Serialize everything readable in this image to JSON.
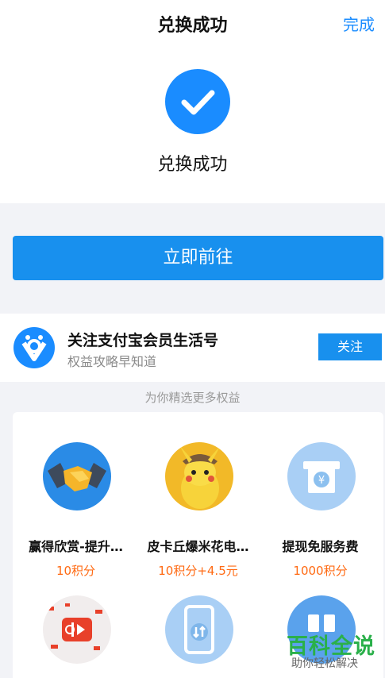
{
  "header": {
    "title": "兑换成功",
    "done_label": "完成"
  },
  "success": {
    "message": "兑换成功"
  },
  "action": {
    "go_label": "立即前往"
  },
  "follow": {
    "title": "关注支付宝会员生活号",
    "subtitle": "权益攻略早知道",
    "button_label": "关注"
  },
  "recommend": {
    "title": "为你精选更多权益",
    "items": [
      {
        "name": "赢得欣赏-提升…",
        "price": "10积分",
        "icon": "handshake-icon"
      },
      {
        "name": "皮卡丘爆米花电…",
        "price": "10积分+4.5元",
        "icon": "pikachu-icon"
      },
      {
        "name": "提现免服务费",
        "price": "1000积分",
        "icon": "atm-yuan-icon"
      },
      {
        "name": "",
        "price": "",
        "icon": "video-app-icon"
      },
      {
        "name": "",
        "price": "",
        "icon": "phone-transfer-icon"
      },
      {
        "name": "",
        "price": "",
        "icon": "cards-icon"
      }
    ]
  },
  "watermark": {
    "line1": "百科全说",
    "line2": "助你轻松解决"
  }
}
